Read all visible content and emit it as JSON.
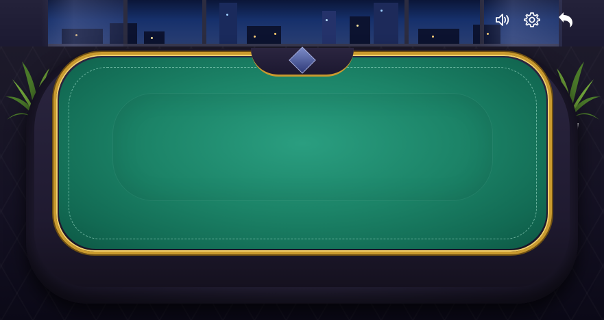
{
  "toolbar": {
    "sound_icon": "speaker-volume-icon",
    "settings_icon": "gear-icon",
    "back_icon": "back-arrow-icon"
  },
  "table": {
    "felt_color": "#1c8468",
    "rail_color": "#c99a2e",
    "leather_color": "#221d34"
  },
  "colors": {
    "background": "#14101f",
    "icon_color": "#ffffff",
    "city_lights": "#ffd27a"
  }
}
